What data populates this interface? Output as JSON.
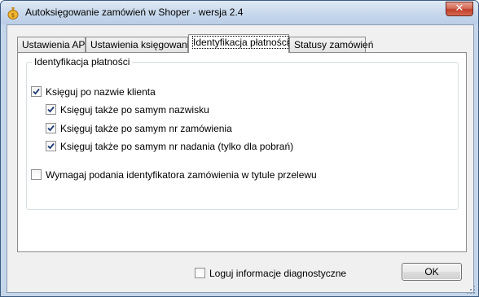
{
  "window": {
    "title": "Autoksięgowanie zamówień w Shoper - wersja 2.4",
    "close_label": "✕"
  },
  "tabs": [
    {
      "label": "Ustawienia API",
      "active": false
    },
    {
      "label": "Ustawienia księgowania",
      "active": false
    },
    {
      "label": "Identyfikacja płatności",
      "active": true
    },
    {
      "label": "Statusy zamówień",
      "active": false
    }
  ],
  "group": {
    "title": "Identyfikacja płatności",
    "options": [
      {
        "label": "Księguj po nazwie klienta",
        "checked": true
      },
      {
        "label": "Księguj także po samym nazwisku",
        "checked": true
      },
      {
        "label": "Księguj także po samym nr zamówienia",
        "checked": true
      },
      {
        "label": "Księguj także po samym nr nadania (tylko dla pobrań)",
        "checked": true
      },
      {
        "label": "Wymagaj podania identyfikatora zamówienia w tytule przelewu",
        "checked": false
      }
    ]
  },
  "footer": {
    "log_label": "Loguj informacje diagnostyczne",
    "log_checked": false,
    "ok_label": "OK"
  },
  "icons": {
    "app": "coin-bag-icon",
    "check": "checkmark-icon",
    "grip": "resize-grip-icon"
  },
  "colors": {
    "titlebar": "#c9d9ec",
    "close": "#c13f2a",
    "check": "#1e3a73"
  }
}
